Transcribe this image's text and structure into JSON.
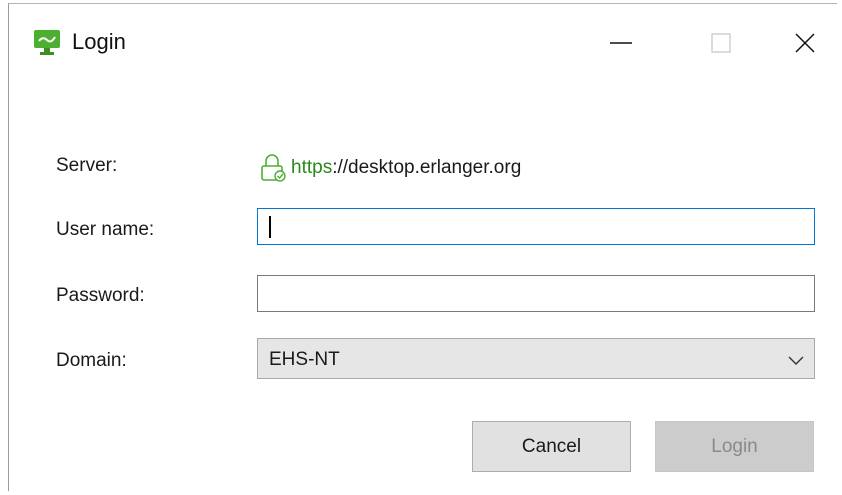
{
  "window": {
    "title": "Login",
    "minimize_icon": "minimize-icon",
    "maximize_icon": "maximize-icon",
    "close_icon": "close-icon"
  },
  "form": {
    "server_label": "Server:",
    "server_scheme": "https",
    "server_rest": "://desktop.erlanger.org",
    "username_label": "User name:",
    "username_value": "",
    "password_label": "Password:",
    "password_value": "",
    "domain_label": "Domain:",
    "domain_value": "EHS-NT"
  },
  "buttons": {
    "cancel": "Cancel",
    "login": "Login"
  },
  "colors": {
    "accent_focus": "#0078d7",
    "secure_green": "#2a8a1a",
    "app_icon_green": "#4caf2f"
  }
}
